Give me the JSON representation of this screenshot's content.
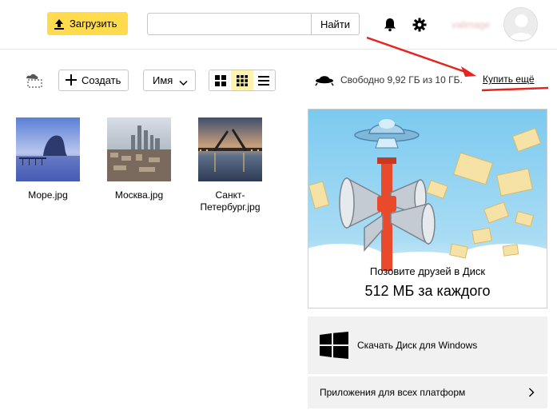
{
  "header": {
    "upload_label": "Загрузить",
    "search_placeholder": "",
    "search_button": "Найти",
    "username": "valimage"
  },
  "toolbar": {
    "create_label": "Создать",
    "sort_label": "Имя",
    "free_space": "Свободно 9,92 ГБ из 10 ГБ.",
    "buy_more": "Купить ещё"
  },
  "files": [
    {
      "name": "Море.jpg"
    },
    {
      "name": "Москва.jpg"
    },
    {
      "name": "Санкт-Петербург.jpg"
    }
  ],
  "promo": {
    "line1": "Позовите друзей в Диск",
    "line2": "512 МБ за каждого"
  },
  "sidebar": {
    "windows_download": "Скачать Диск для Windows",
    "all_platforms": "Приложения для всех платформ"
  },
  "colors": {
    "accent": "#ffdb4d",
    "annotation": "#e8231e",
    "active_view": "#fff3b0"
  }
}
